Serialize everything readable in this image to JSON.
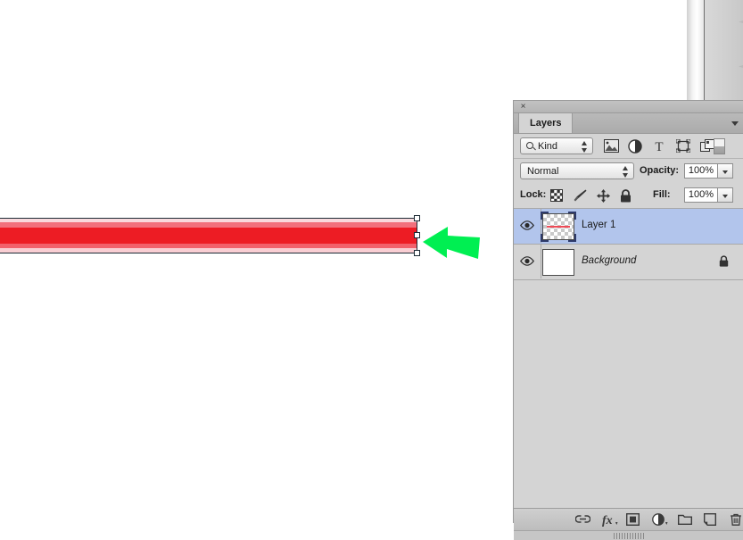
{
  "app": {
    "panel_title": "Layers",
    "close_label": "×"
  },
  "filter": {
    "kind_label": "Kind",
    "search_icon": "magnifier-icon",
    "icons": [
      {
        "name": "filter-pixel-layers-icon",
        "title": "Pixel layers"
      },
      {
        "name": "filter-adjustment-layers-icon",
        "title": "Adjustment layers"
      },
      {
        "name": "filter-type-layers-icon",
        "title": "Type layers"
      },
      {
        "name": "filter-shape-layers-icon",
        "title": "Shape layers"
      },
      {
        "name": "filter-smart-object-layers-icon",
        "title": "Smart objects"
      }
    ],
    "toggle_name": "filter-enable-toggle"
  },
  "blend": {
    "mode": "Normal",
    "opacity_label": "Opacity:",
    "opacity_value": "100%"
  },
  "lock": {
    "label": "Lock:",
    "fill_label": "Fill:",
    "fill_value": "100%",
    "icons": [
      {
        "name": "lock-transparent-pixels-icon"
      },
      {
        "name": "lock-image-pixels-icon"
      },
      {
        "name": "lock-position-icon"
      },
      {
        "name": "lock-all-icon"
      }
    ]
  },
  "layers": [
    {
      "name": "Layer 1",
      "visible": true,
      "selected": true,
      "italic": false,
      "locked": false,
      "thumbnail": "transparent-with-red-line"
    },
    {
      "name": "Background",
      "visible": true,
      "selected": false,
      "italic": true,
      "locked": true,
      "thumbnail": "white"
    }
  ],
  "panel_bottom_buttons": [
    {
      "name": "link-layers-button",
      "icon": "link-icon"
    },
    {
      "name": "layer-style-button",
      "icon": "fx-icon"
    },
    {
      "name": "add-layer-mask-button",
      "icon": "mask-icon"
    },
    {
      "name": "new-adjustment-layer-button",
      "icon": "adjustment-icon"
    },
    {
      "name": "new-group-button",
      "icon": "folder-icon"
    },
    {
      "name": "new-layer-button",
      "icon": "new-layer-icon"
    },
    {
      "name": "delete-layer-button",
      "icon": "trash-icon"
    }
  ],
  "canvas": {
    "shape_name": "red-bar-shape",
    "shape_colors": [
      "#f9d9dd",
      "#f2707c",
      "#ed1c24",
      "#f2606b",
      "#f9ced3"
    ],
    "selection_color": "#1d2b35",
    "annotation_arrow_color": "#00ef52",
    "annotation_arrow_direction": "left",
    "handles": [
      "top-right",
      "middle-right",
      "bottom-right"
    ]
  }
}
